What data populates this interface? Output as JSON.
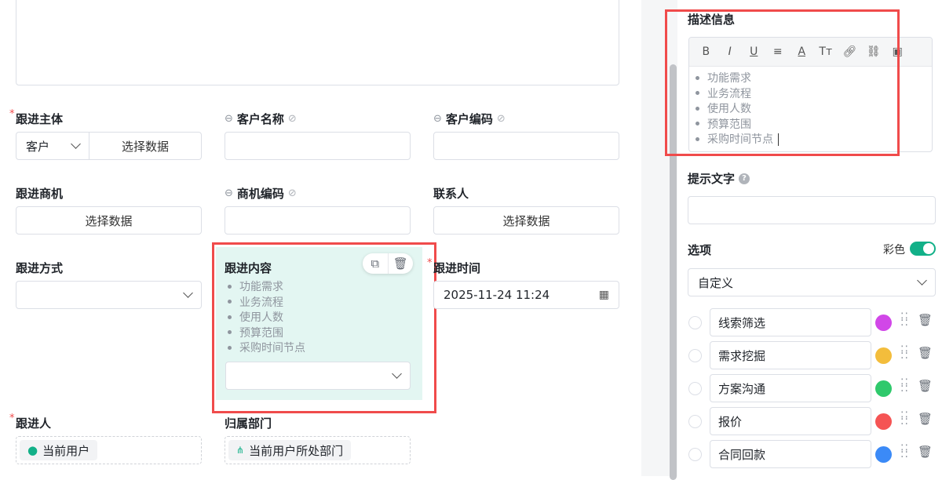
{
  "form": {
    "follow_subject": {
      "label": "跟进主体",
      "type_value": "客户",
      "select_button": "选择数据"
    },
    "customer_name": {
      "label": "客户名称"
    },
    "customer_code": {
      "label": "客户编码"
    },
    "opportunity": {
      "label": "跟进商机",
      "select_button": "选择数据"
    },
    "opportunity_code": {
      "label": "商机编码"
    },
    "contact": {
      "label": "联系人",
      "select_button": "选择数据"
    },
    "method": {
      "label": "跟进方式"
    },
    "content": {
      "label": "跟进内容",
      "bullets": [
        "功能需求",
        "业务流程",
        "使用人数",
        "预算范围",
        "采购时间节点"
      ]
    },
    "time": {
      "label": "跟进时间",
      "value": "2025-11-24 11:24"
    },
    "follower": {
      "label": "跟进人",
      "value": "当前用户"
    },
    "department": {
      "label": "归属部门",
      "value": "当前用户所处部门"
    }
  },
  "panel": {
    "description": {
      "label": "描述信息",
      "toolbar": [
        "B",
        "I",
        "U",
        "≡",
        "A",
        "Tт",
        "link",
        "unlink",
        "image"
      ],
      "bullets": [
        "功能需求",
        "业务流程",
        "使用人数",
        "预算范围",
        "采购时间节点"
      ]
    },
    "hint": {
      "label": "提示文字",
      "value": ""
    },
    "options": {
      "label": "选项",
      "color_toggle_label": "彩色",
      "color_toggle_on": true,
      "source": "自定义",
      "items": [
        {
          "label": "线索筛选",
          "color": "#d147e8"
        },
        {
          "label": "需求挖掘",
          "color": "#f3bd3c"
        },
        {
          "label": "方案沟通",
          "color": "#2fc96c"
        },
        {
          "label": "报价",
          "color": "#f55454"
        },
        {
          "label": "合同回款",
          "color": "#3b8af7"
        }
      ]
    }
  },
  "colors": {
    "accent": "#12b088",
    "highlight": "#f04b4b",
    "selected_bg": "#e3f6f2"
  }
}
